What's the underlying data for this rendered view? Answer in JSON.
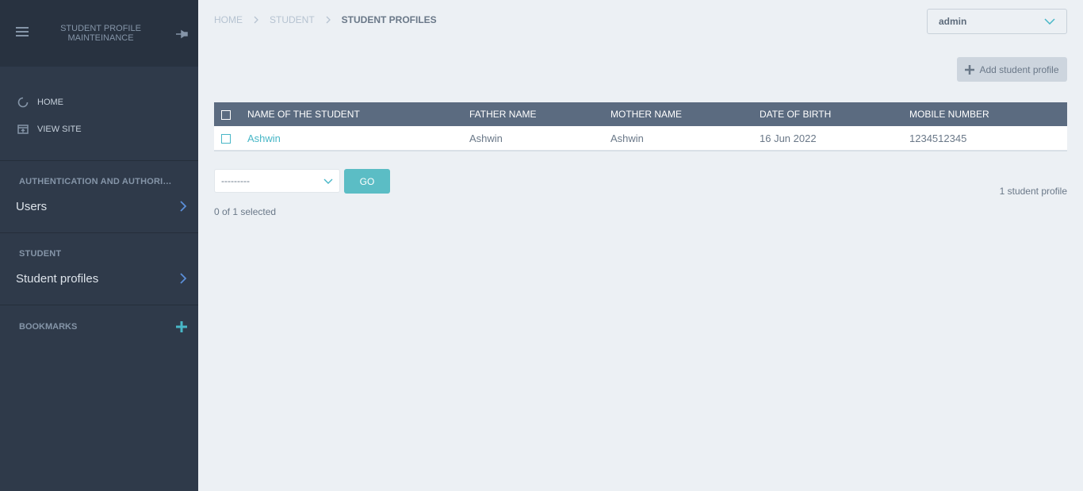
{
  "sidebar": {
    "brand": "STUDENT PROFILE MAINTEINANCE",
    "links": [
      {
        "label": "HOME"
      },
      {
        "label": "VIEW SITE"
      }
    ],
    "sections": [
      {
        "title": "AUTHENTICATION AND AUTHORIZATION",
        "items": [
          {
            "label": "Users"
          }
        ]
      },
      {
        "title": "STUDENT",
        "items": [
          {
            "label": "Student profiles"
          }
        ]
      }
    ],
    "bookmarks_title": "BOOKMARKS"
  },
  "breadcrumb": [
    "HOME",
    "STUDENT",
    "STUDENT PROFILES"
  ],
  "user_menu": {
    "value": "admin"
  },
  "add_button_label": "Add student profile",
  "table": {
    "columns": [
      "NAME OF THE STUDENT",
      "FATHER NAME",
      "MOTHER NAME",
      "DATE OF BIRTH",
      "MOBILE NUMBER"
    ],
    "rows": [
      [
        "Ashwin",
        "Ashwin",
        "Ashwin",
        "16 Jun 2022",
        "1234512345"
      ]
    ]
  },
  "actions": {
    "select_value": "---------",
    "go_label": "GO",
    "selected_text": "0 of 1 selected",
    "result_count": "1 student profile"
  },
  "colors": {
    "sidebar_bg": "#2f3a4a",
    "accent": "#48b7c7",
    "table_header": "#5b6b80"
  }
}
